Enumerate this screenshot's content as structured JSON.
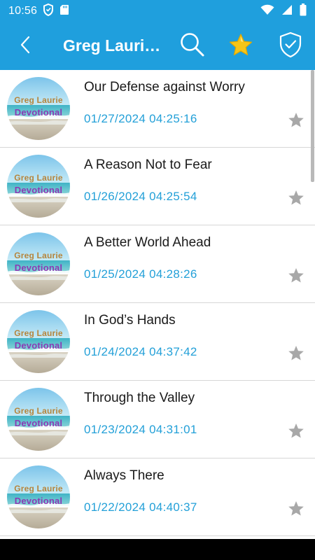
{
  "status_bar": {
    "time": "10:56",
    "icons": [
      "shield-icon",
      "sd-card-icon",
      "wifi-icon",
      "signal-icon",
      "battery-icon"
    ]
  },
  "toolbar": {
    "title": "Greg Lauri…",
    "back_icon": "chevron-left-icon",
    "search_icon": "search-icon",
    "favorites_icon": "star-icon",
    "shield_icon": "shield-check-icon"
  },
  "thumbnail_text": {
    "line1": "Greg Laurie",
    "line2": "Devotional"
  },
  "items": [
    {
      "title": "Our Defense against Worry",
      "date": "01/27/2024 04:25:16"
    },
    {
      "title": "A Reason Not to Fear",
      "date": "01/26/2024 04:25:54"
    },
    {
      "title": "A Better World Ahead",
      "date": "01/25/2024 04:28:26"
    },
    {
      "title": "In God’s Hands",
      "date": "01/24/2024 04:37:42"
    },
    {
      "title": "Through the Valley",
      "date": "01/23/2024 04:31:01"
    },
    {
      "title": "Always There",
      "date": "01/22/2024 04:40:37"
    }
  ],
  "colors": {
    "appbar": "#1f9fdd",
    "date_text": "#23a0d8",
    "star_active": "#f5c518",
    "star_inactive": "#a8a8a8"
  }
}
